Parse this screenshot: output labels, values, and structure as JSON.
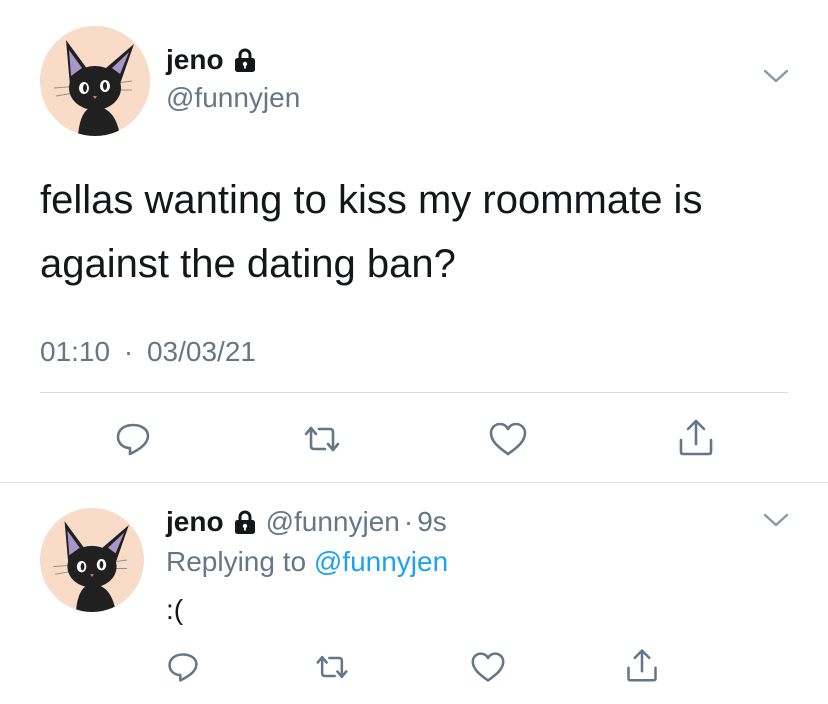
{
  "main_tweet": {
    "name": "jeno",
    "handle": "@funnyjen",
    "text_line1": "fellas wanting to kiss my roommate is",
    "text_line2": "against the dating ban?",
    "time": "01:10",
    "separator": "·",
    "date": "03/03/21",
    "protected": true,
    "avatar_icon": "black-cat-avatar-icon",
    "actions": [
      "reply-icon",
      "retweet-icon",
      "like-icon",
      "share-icon"
    ]
  },
  "reply_tweet": {
    "name": "jeno",
    "handle": "@funnyjen",
    "separator": "·",
    "age": "9s",
    "replying_prefix": "Replying to",
    "replying_to": "@funnyjen",
    "text": ":(",
    "protected": true,
    "avatar_icon": "black-cat-avatar-icon",
    "actions": [
      "reply-icon",
      "retweet-icon",
      "like-icon",
      "share-icon"
    ]
  },
  "colors": {
    "text": "#14171a",
    "secondary": "#657786",
    "link": "#1da1f2",
    "divider": "#d7dde2",
    "avatar_bg": "#f8dcc8"
  }
}
